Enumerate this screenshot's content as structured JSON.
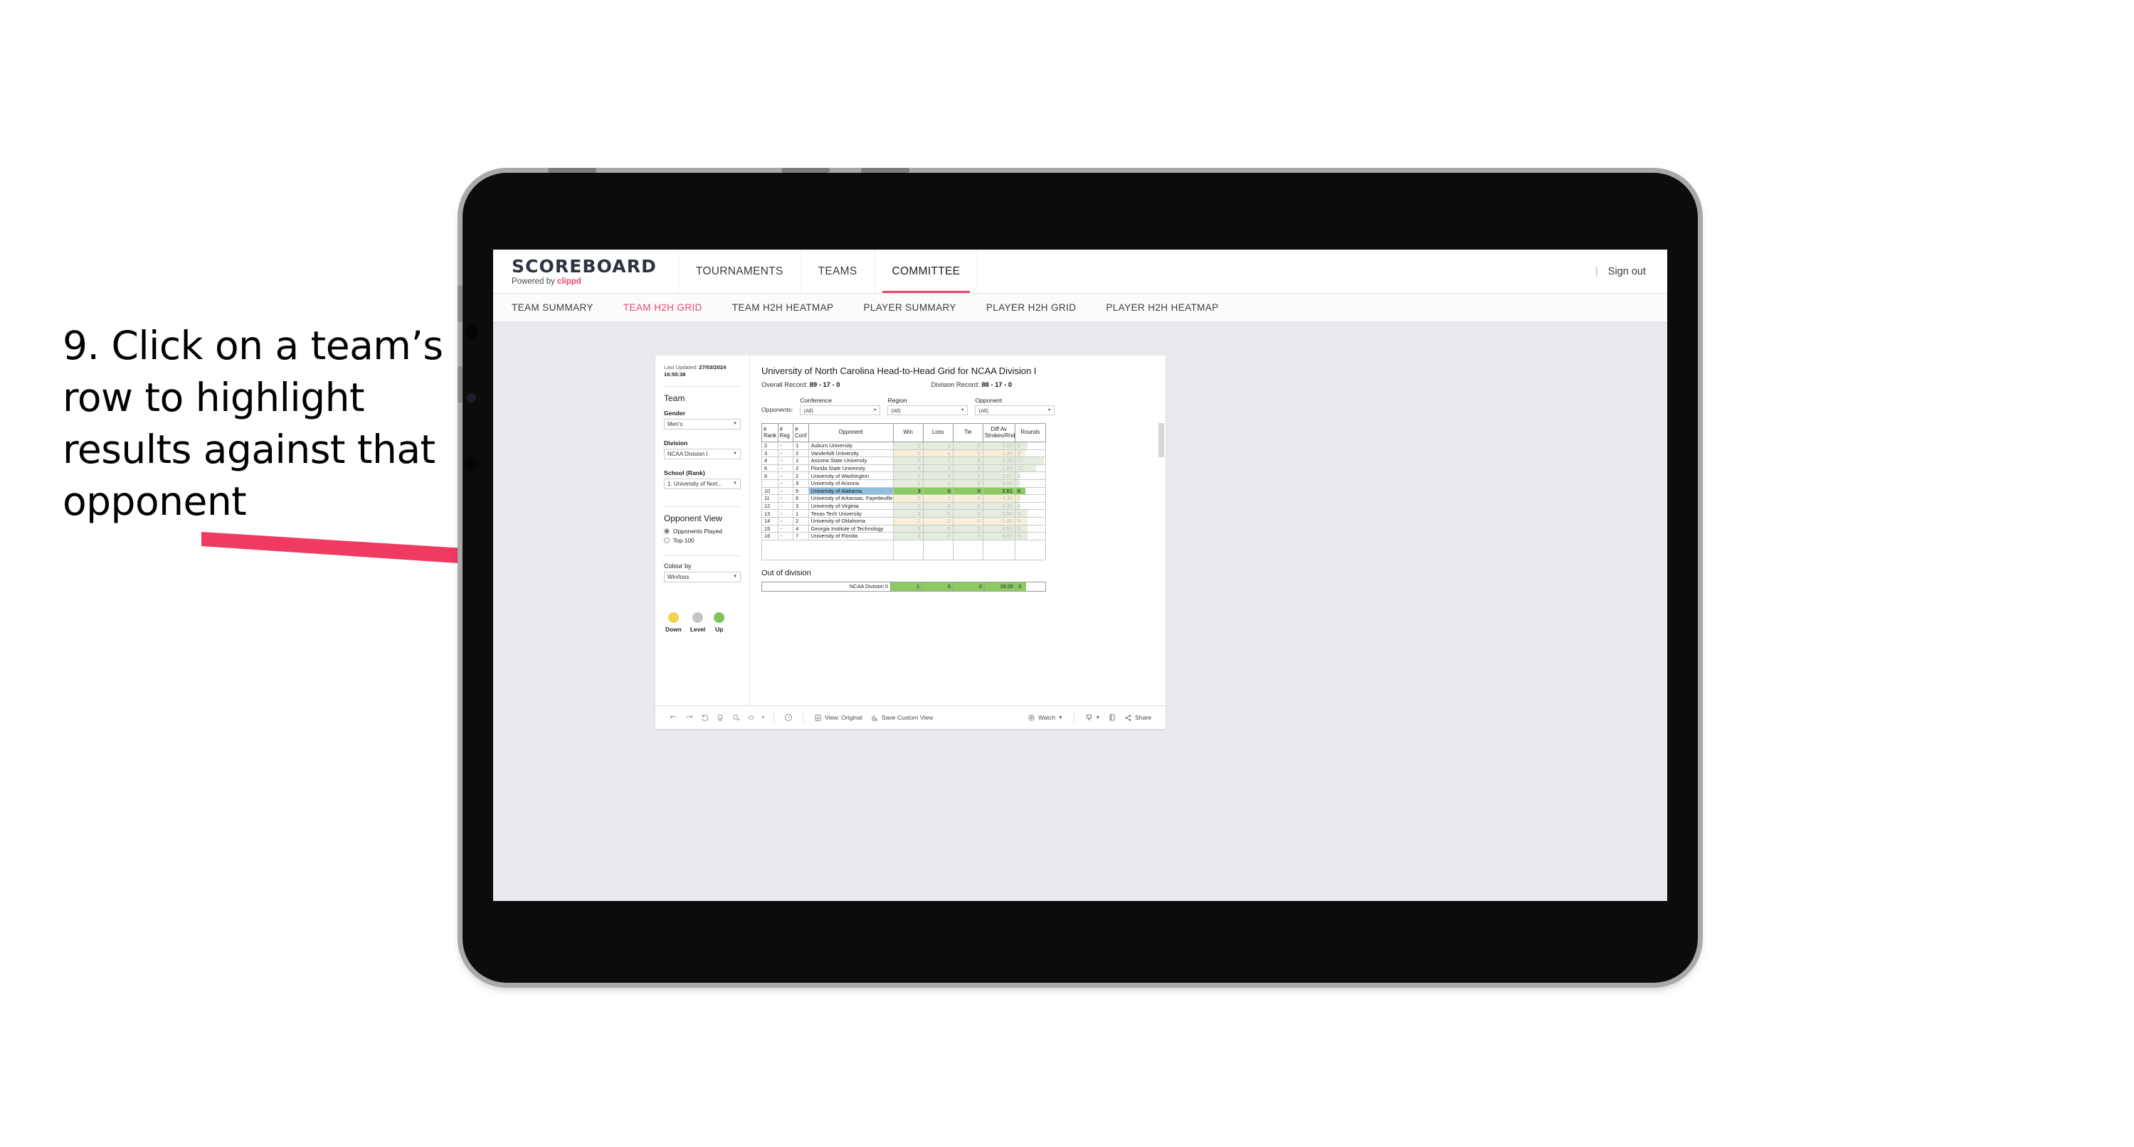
{
  "annotation": {
    "text": "9. Click on a team’s row to highlight results against that opponent",
    "arrow_color": "#ef3b62"
  },
  "topbar": {
    "logo_main": "SCOREBOARD",
    "logo_sub_prefix": "Powered by ",
    "logo_sub_brand": "clippd",
    "nav": [
      {
        "label": "TOURNAMENTS",
        "active": false
      },
      {
        "label": "TEAMS",
        "active": false
      },
      {
        "label": "COMMITTEE",
        "active": true
      }
    ],
    "divider": "|",
    "signout": "Sign out"
  },
  "subnav": [
    {
      "label": "TEAM SUMMARY",
      "active": false
    },
    {
      "label": "TEAM H2H GRID",
      "active": true
    },
    {
      "label": "TEAM H2H HEATMAP",
      "active": false
    },
    {
      "label": "PLAYER SUMMARY",
      "active": false
    },
    {
      "label": "PLAYER H2H GRID",
      "active": false
    },
    {
      "label": "PLAYER H2H HEATMAP",
      "active": false
    }
  ],
  "panel": {
    "last_updated_label": "Last Updated: ",
    "last_updated_value": "27/03/2024 16:55:38",
    "team_heading": "Team",
    "gender_label": "Gender",
    "gender_value": "Men’s",
    "division_label": "Division",
    "division_value": "NCAA Division I",
    "school_label": "School (Rank)",
    "school_value": "1. University of Nort...",
    "opponent_view_heading": "Opponent View",
    "radio_opponents_played": "Opponents Played",
    "radio_top_100": "Top 100",
    "colour_by_label": "Colour by",
    "colour_by_value": "Win/loss",
    "legend": [
      {
        "label": "Down",
        "color": "#f2d34e"
      },
      {
        "label": "Level",
        "color": "#c2c6c9"
      },
      {
        "label": "Up",
        "color": "#7dc35b"
      }
    ]
  },
  "main": {
    "title": "University of North Carolina Head-to-Head Grid for NCAA Division I",
    "overall_record_label": "Overall Record: ",
    "overall_record_value": "89 - 17 - 0",
    "division_record_label": "Division Record: ",
    "division_record_value": "88 - 17 - 0",
    "opponents_label": "Opponents:",
    "filters": [
      {
        "label": "Conference",
        "value": "(All)"
      },
      {
        "label": "Region",
        "value": "(All)"
      },
      {
        "label": "Opponent",
        "value": "(All)"
      }
    ],
    "columns": [
      "#\nRank",
      "#\nReg",
      "#\nConf",
      "Opponent",
      "Win",
      "Loss",
      "Tie",
      "Diff Av\nStrokes/Rnd",
      "Rounds"
    ],
    "columns_flat": [
      "# Rank",
      "# Reg",
      "# Conf",
      "Opponent",
      "Win",
      "Loss",
      "Tie",
      "Diff Av Strokes/Rnd",
      "Rounds"
    ],
    "out_of_division_heading": "Out of division"
  },
  "chart_data": {
    "type": "table",
    "title": "University of North Carolina Head-to-Head Grid for NCAA Division I",
    "columns": [
      "# Rank",
      "# Reg",
      "# Conf",
      "Opponent",
      "Win",
      "Loss",
      "Tie",
      "Diff Av Strokes/Rnd",
      "Rounds"
    ],
    "rows": [
      {
        "rank": "2",
        "reg": "-",
        "conf": "1",
        "opponent": "Auburn University",
        "win": "2",
        "loss": "1",
        "tie": "0",
        "diff": "1.67",
        "rounds": "9",
        "state": "win",
        "selected": false,
        "bar_pct": 40
      },
      {
        "rank": "3",
        "reg": "-",
        "conf": "2",
        "opponent": "Vanderbilt University",
        "win": "0",
        "loss": "4",
        "tie": "0",
        "diff": "-2.29",
        "rounds": "8",
        "state": "loss",
        "selected": false,
        "bar_pct": 34
      },
      {
        "rank": "4",
        "reg": "-",
        "conf": "1",
        "opponent": "Arizona State University",
        "win": "5",
        "loss": "1",
        "tie": "0",
        "diff": "2.28",
        "rounds": "17",
        "state": "win",
        "selected": false,
        "bar_pct": 95
      },
      {
        "rank": "6",
        "reg": "-",
        "conf": "2",
        "opponent": "Florida State University",
        "win": "4",
        "loss": "2",
        "tie": "0",
        "diff": "1.83",
        "rounds": "12",
        "state": "win",
        "selected": false,
        "bar_pct": 68
      },
      {
        "rank": "8",
        "reg": "-",
        "conf": "2",
        "opponent": "University of Washington",
        "win": "1",
        "loss": "0",
        "tie": "0",
        "diff": "3.67",
        "rounds": "3",
        "state": "win",
        "selected": false,
        "bar_pct": 14
      },
      {
        "rank": "",
        "reg": "-",
        "conf": "3",
        "opponent": "University of Arizona",
        "win": "1",
        "loss": "0",
        "tie": "0",
        "diff": "9.00",
        "rounds": "2",
        "state": "win",
        "selected": false,
        "bar_pct": 10
      },
      {
        "rank": "10",
        "reg": "-",
        "conf": "5",
        "opponent": "University of Alabama",
        "win": "3",
        "loss": "0",
        "tie": "0",
        "diff": "2.61",
        "rounds": "8",
        "state": "win",
        "selected": true,
        "bar_pct": 34
      },
      {
        "rank": "11",
        "reg": "-",
        "conf": "6",
        "opponent": "University of Arkansas, Fayetteville",
        "win": "0",
        "loss": "1",
        "tie": "0",
        "diff": "-4.33",
        "rounds": "3",
        "state": "loss",
        "selected": false,
        "bar_pct": 14
      },
      {
        "rank": "12",
        "reg": "-",
        "conf": "3",
        "opponent": "University of Virginia",
        "win": "1",
        "loss": "0",
        "tie": "0",
        "diff": "2.33",
        "rounds": "3",
        "state": "win",
        "selected": false,
        "bar_pct": 14
      },
      {
        "rank": "13",
        "reg": "-",
        "conf": "1",
        "opponent": "Texas Tech University",
        "win": "3",
        "loss": "0",
        "tie": "0",
        "diff": "5.56",
        "rounds": "9",
        "state": "win",
        "selected": false,
        "bar_pct": 40
      },
      {
        "rank": "14",
        "reg": "-",
        "conf": "2",
        "opponent": "University of Oklahoma",
        "win": "1",
        "loss": "2",
        "tie": "0",
        "diff": "-1.00",
        "rounds": "9",
        "state": "loss",
        "selected": false,
        "bar_pct": 40
      },
      {
        "rank": "15",
        "reg": "-",
        "conf": "4",
        "opponent": "Georgia Institute of Technology",
        "win": "5",
        "loss": "0",
        "tie": "0",
        "diff": "4.50",
        "rounds": "9",
        "state": "win",
        "selected": false,
        "bar_pct": 40
      },
      {
        "rank": "16",
        "reg": "-",
        "conf": "7",
        "opponent": "University of Florida",
        "win": "3",
        "loss": "1",
        "tie": "0",
        "diff": "6.62",
        "rounds": "9",
        "state": "win",
        "selected": false,
        "bar_pct": 40
      }
    ],
    "out_of_division": [
      {
        "name": "NCAA Division II",
        "win": "1",
        "loss": "0",
        "tie": "0",
        "diff": "26.00",
        "rounds": "3"
      }
    ]
  },
  "toolbar": {
    "view_label": "View: Original",
    "save_label": "Save Custom View",
    "watch_label": "Watch",
    "share_label": "Share"
  }
}
